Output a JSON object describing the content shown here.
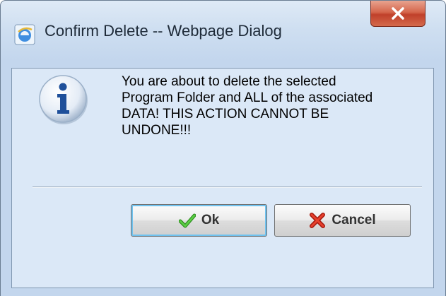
{
  "window": {
    "title": "Confirm Delete -- Webpage Dialog",
    "title_icon": "ie-icon",
    "close_icon": "close-x-icon"
  },
  "dialog": {
    "icon": "info-icon",
    "message": "You are about to delete the selected\nProgram Folder and ALL of the associated\nDATA! THIS ACTION CANNOT BE\nUNDONE!!!"
  },
  "buttons": {
    "ok_label": "Ok",
    "ok_icon": "checkmark-icon",
    "cancel_label": "Cancel",
    "cancel_icon": "red-x-icon"
  },
  "colors": {
    "titlebar": "#cfdff1",
    "client_background": "#dbe8f7",
    "close_button": "#c0402a",
    "ok_focus_ring": "#6fc2ef",
    "checkmark": "#3aa829",
    "cancel_x": "#d42a1a",
    "info_icon_letter": "#1e4f9a"
  }
}
